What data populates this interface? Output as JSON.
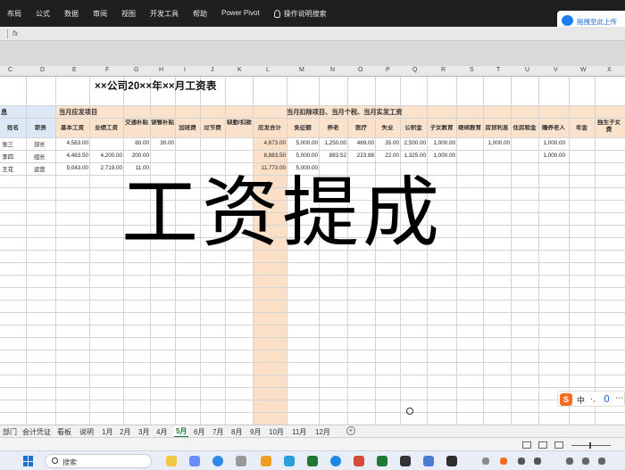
{
  "ribbon": {
    "tabs": [
      "布局",
      "公式",
      "数据",
      "审阅",
      "视图",
      "开发工具",
      "帮助",
      "Power Pivot"
    ],
    "tell_me": "操作说明搜索"
  },
  "formula_bar": {
    "fx": "fx"
  },
  "badge": {
    "label": "拖拽至此上传"
  },
  "columns": [
    "C",
    "D",
    "E",
    "F",
    "G",
    "H",
    "I",
    "J",
    "K",
    "L",
    "M",
    "N",
    "O",
    "P",
    "Q",
    "R",
    "S",
    "T",
    "U",
    "V",
    "W",
    "X"
  ],
  "sheet": {
    "title": "××公司20××年××月工资表",
    "section_info": "息",
    "section_income": "当月应发项目",
    "section_deduct": "当月扣除项目、当月个税、当月实发工资",
    "headers": {
      "name": "姓名",
      "position": "职务",
      "base": "基本工资",
      "performance": "业绩工资",
      "traffic": "交通补贴",
      "meal": "误餐补贴",
      "overtime": "加班费",
      "holiday": "过节费",
      "absence": "缺勤/扣款",
      "payable": "应发合计",
      "exempt": "免征额",
      "pension": "养老",
      "medical": "医疗",
      "unemployment": "失业",
      "housing_fund": "公积金",
      "children_edu": "子女教育",
      "continuing_edu": "继续教育",
      "mortgage": "房贷利息",
      "rent": "住房租金",
      "elderly": "赡养老人",
      "annuity": "年金",
      "only_child": "独生子女费"
    },
    "rows": [
      {
        "name": "张三",
        "position": "部长",
        "base": "4,563.00",
        "performance": "",
        "traffic": "80.00",
        "meal": "30.00",
        "payable": "4,673.00",
        "exempt": "5,000.00",
        "pension": "1,250.00",
        "medical": "469.00",
        "unemployment": "35.00",
        "housing_fund": "2,500.00",
        "children_edu": "1,000.00",
        "mortgage": "1,000.00",
        "elderly": "1,000.00"
      },
      {
        "name": "李四",
        "position": "组长",
        "base": "4,483.50",
        "performance": "4,200.00",
        "traffic": "200.00",
        "meal": "",
        "payable": "8,883.50",
        "exempt": "5,000.00",
        "pension": "883.52",
        "medical": "223.88",
        "unemployment": "22.00",
        "housing_fund": "1,325.00",
        "children_edu": "1,000.00",
        "mortgage": "",
        "elderly": "1,000.00"
      },
      {
        "name": "王花",
        "position": "运营",
        "base": "9,043.00",
        "performance": "2,719.00",
        "traffic": "11.00",
        "meal": "",
        "payable": "11,773.00",
        "exempt": "5,000.00",
        "pension": "",
        "medical": "",
        "unemployment": "",
        "housing_fund": "",
        "children_edu": "",
        "mortgage": "",
        "elderly": ""
      }
    ]
  },
  "overlay_text": "工资提成",
  "sheet_tabs": [
    "部门",
    "会计凭证",
    "看板",
    "说明",
    "1月",
    "2月",
    "3月",
    "4月",
    "5月",
    "6月",
    "7月",
    "8月",
    "9月",
    "10月",
    "11月",
    "12月"
  ],
  "active_sheet": "5月",
  "add_sheet_symbol": "+",
  "ime": {
    "logo": "S",
    "lang": "中",
    "punct": "·,",
    "more": "⋯"
  },
  "taskbar": {
    "search_label": "搜索"
  },
  "colors": {
    "peach": "#fbe2cc",
    "light_blue": "#dce8f5",
    "excel_green": "#1c7a34",
    "ime_orange": "#f26d21"
  }
}
